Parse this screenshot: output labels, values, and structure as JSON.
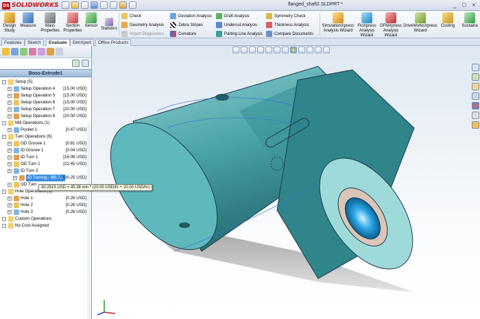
{
  "app": {
    "logo_text": "SOLIDWORKS",
    "logo_mark": "DS",
    "document_title": "flanged_shaft2.SLDPRT *",
    "window_controls": [
      "_",
      "□",
      "×"
    ]
  },
  "ribbon": {
    "large_buttons": [
      {
        "label": "Design Study",
        "icon": "design-study-icon"
      },
      {
        "label": "Measure",
        "icon": "measure-icon"
      },
      {
        "label": "Mass Properties",
        "icon": "mass-properties-icon"
      },
      {
        "label": "Section Properties",
        "icon": "section-properties-icon"
      },
      {
        "label": "Sensor",
        "icon": "sensor-icon"
      },
      {
        "label": "Statistics",
        "icon": "statistics-icon"
      }
    ],
    "small_col1": [
      "Check",
      "Geometry Analysis",
      "Import Diagnostics"
    ],
    "small_col2": [
      "Deviation Analysis",
      "Zebra Stripes",
      "Curvature"
    ],
    "small_col3": [
      "Draft Analysis",
      "Undercut Analysis",
      "Parting Line Analysis"
    ],
    "small_col4": [
      "Symmetry Check",
      "Thickness Analysis",
      "Compare Documents"
    ],
    "right_buttons": [
      {
        "label": "SimulationXpress Analysis Wizard",
        "icon": "simulation-icon"
      },
      {
        "label": "FloXpress Analysis Wizard",
        "icon": "floxpress-icon"
      },
      {
        "label": "DFMXpress Analysis Wizard",
        "icon": "dfmxpress-icon"
      },
      {
        "label": "DriveWorksXpress Wizard",
        "icon": "driveworks-icon"
      },
      {
        "label": "Costing",
        "icon": "costing-icon"
      },
      {
        "label": "Sustaina",
        "icon": "sustainability-icon"
      }
    ]
  },
  "tabs": [
    "Features",
    "Sketch",
    "Evaluate",
    "DimXpert",
    "Office Products"
  ],
  "active_tab": "Evaluate",
  "left_panel": {
    "header": "Boss-Extrude1",
    "tree": [
      {
        "label": "Setup (5)",
        "value": "",
        "level": 0
      },
      {
        "label": "Setup Operation 4",
        "value": "[15.00 USD]",
        "level": 1
      },
      {
        "label": "Setup Operation 5",
        "value": "[15.00 USD]",
        "level": 1
      },
      {
        "label": "Setup Operation 6",
        "value": "[15.00 USD]",
        "level": 1
      },
      {
        "label": "Setup Operation 7",
        "value": "[20.00 USD]",
        "level": 1
      },
      {
        "label": "Setup Operation 8",
        "value": "[20.00 USD]",
        "level": 1
      },
      {
        "label": "Mill Operations (1)",
        "value": "",
        "level": 0
      },
      {
        "label": "Pocket 1",
        "value": "[0.47 USD]",
        "level": 1
      },
      {
        "label": "Turn Operations (6)",
        "value": "",
        "level": 0
      },
      {
        "label": "OD Groove 1",
        "value": "[0.81 USD]",
        "level": 1
      },
      {
        "label": "ID Groove 1",
        "value": "[0.04 USD]",
        "level": 1
      },
      {
        "label": "ID Turn 1",
        "value": "[16.06 USD]",
        "level": 1
      },
      {
        "label": "OD Turn 1",
        "value": "[22.45 USD]",
        "level": 1
      },
      {
        "label": "ID Turn 2",
        "value": "",
        "level": 1
      },
      {
        "label": "ID Turning - Ø0.7...",
        "value": "[30.25 USD]",
        "level": 2,
        "selected": true
      },
      {
        "label": "OD Turn",
        "value": "",
        "level": 1
      },
      {
        "label": "Hole Operations (3)",
        "value": "",
        "level": 0
      },
      {
        "label": "Hole 1",
        "value": "[0.26 USD]",
        "level": 1
      },
      {
        "label": "Hole 2",
        "value": "[0.26 USD]",
        "level": 1
      },
      {
        "label": "Hole 3",
        "value": "[0.26 USD]",
        "level": 1
      },
      {
        "label": "Custom Operations",
        "value": "",
        "level": 0
      },
      {
        "label": "No Cost Assigned",
        "value": "",
        "level": 0
      }
    ],
    "tooltip": "30.2515 USD = 45.38 min * (20.00 USD/hr + 20.00 USD/hr)"
  },
  "colors": {
    "part_fill": "#4aa3a7",
    "part_edge": "#1a3a4a",
    "bore_blue": "#2ba7e6",
    "ribbon_bg": "#eef2f8"
  }
}
